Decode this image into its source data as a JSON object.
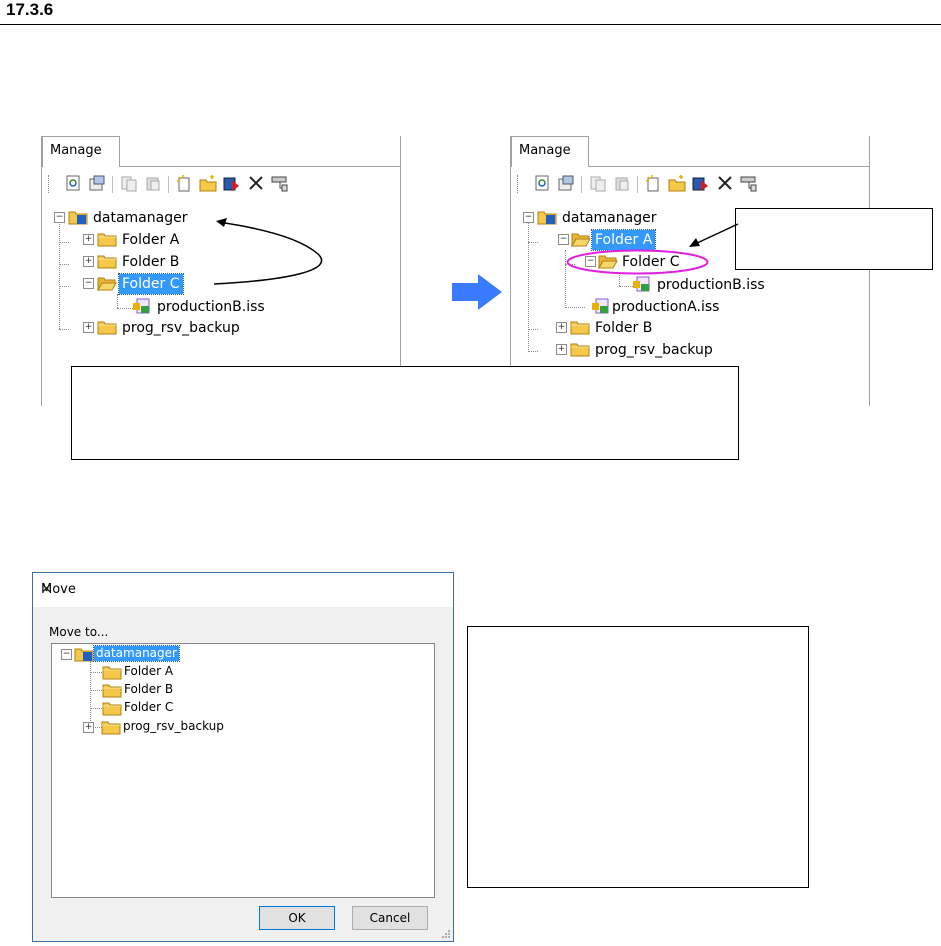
{
  "heading": "17.3.6",
  "panel": {
    "tab_label": "Manage",
    "toolbar_icons": [
      "refresh-icon",
      "properties-icon",
      "copy-icon",
      "paste-icon",
      "new-file-icon",
      "new-folder-icon",
      "move-icon",
      "delete-icon",
      "settings-icon"
    ]
  },
  "tree_before": {
    "root": "datamanager",
    "folder_a": "Folder A",
    "folder_b": "Folder B",
    "folder_c": "Folder C",
    "file_b": "productionB.iss",
    "backup": "prog_rsv_backup"
  },
  "tree_after": {
    "root": "datamanager",
    "folder_a": "Folder A",
    "folder_c": "Folder C",
    "file_b": "productionB.iss",
    "file_a": "productionA.iss",
    "folder_b": "Folder B",
    "backup": "prog_rsv_backup"
  },
  "dialog": {
    "title": "Move",
    "close": "✕",
    "move_to_label": "Move to...",
    "tree": {
      "root": "datamanager",
      "folder_a": "Folder A",
      "folder_b": "Folder B",
      "folder_c": "Folder C",
      "backup": "prog_rsv_backup"
    },
    "ok": "OK",
    "cancel": "Cancel"
  },
  "colors": {
    "selection": "#3399ff",
    "highlight_ellipse": "#e020e0",
    "big_arrow": "#3b7cff"
  }
}
